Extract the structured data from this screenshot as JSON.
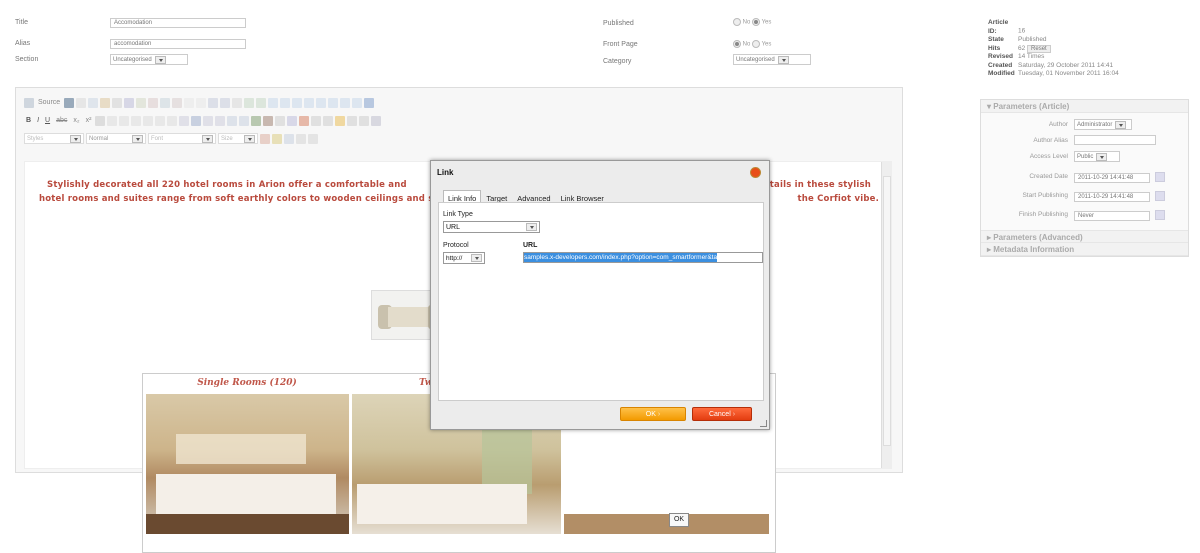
{
  "form": {
    "title_label": "Title",
    "title_value": "Accomodation",
    "alias_label": "Alias",
    "alias_value": "accomodation",
    "section_label": "Section",
    "section_value": "Uncategorised",
    "published_label": "Published",
    "frontpage_label": "Front Page",
    "category_label": "Category",
    "category_value": "Uncategorised",
    "no_label": "No",
    "yes_label": "Yes"
  },
  "info": {
    "id_label": "Article ID:",
    "id_value": "16",
    "state_label": "State",
    "state_value": "Published",
    "hits_label": "Hits",
    "hits_value": "62",
    "reset_label": "Reset",
    "revised_label": "Revised",
    "revised_value": "14 Times",
    "created_label": "Created",
    "created_value": "Saturday, 29 October 2011 14:41",
    "modified_label": "Modified",
    "modified_value": "Tuesday, 01 November 2011 16:04"
  },
  "params": {
    "header": "Parameters (Article)",
    "author_label": "Author",
    "author_value": "Administrator",
    "alias_label": "Author Alias",
    "access_label": "Access Level",
    "access_value": "Public",
    "created_label": "Created Date",
    "created_value": "2011-10-29 14:41:48",
    "start_label": "Start Publishing",
    "start_value": "2011-10-29 14:41:48",
    "finish_label": "Finish Publishing",
    "finish_value": "Never",
    "adv_header": "Parameters (Advanced)",
    "meta_header": "Metadata Information"
  },
  "toolbar": {
    "source_label": "Source",
    "styles": "Styles",
    "format": "Normal",
    "font": "Font",
    "size": "Size"
  },
  "content": {
    "para_line1": "Stylishly decorated all 220 hotel rooms in Arion offer a comfortable and",
    "para_line1_end": "tails in these stylish",
    "para_line2": "hotel rooms and suites range from soft earthly colors to wooden ceilings and st",
    "para_line2_end": "the Corfiot vibe.",
    "caption1": "Single Rooms (120)",
    "caption2": "Twi",
    "ok_label": "OK"
  },
  "dialog": {
    "title": "Link",
    "tabs": [
      "Link Info",
      "Target",
      "Advanced",
      "Link Browser"
    ],
    "linktype_label": "Link Type",
    "linktype_value": "URL",
    "protocol_label": "Protocol",
    "protocol_value": "http://",
    "url_label": "URL",
    "url_value": "samples.x-developers.com/index.php?option=com_smartformer&ta",
    "ok_label": "OK",
    "cancel_label": "Cancel"
  },
  "colors": {
    "accent": "#b94a3d",
    "ok": "#f39a00",
    "cancel": "#e33d10",
    "close": "#e84e17"
  }
}
